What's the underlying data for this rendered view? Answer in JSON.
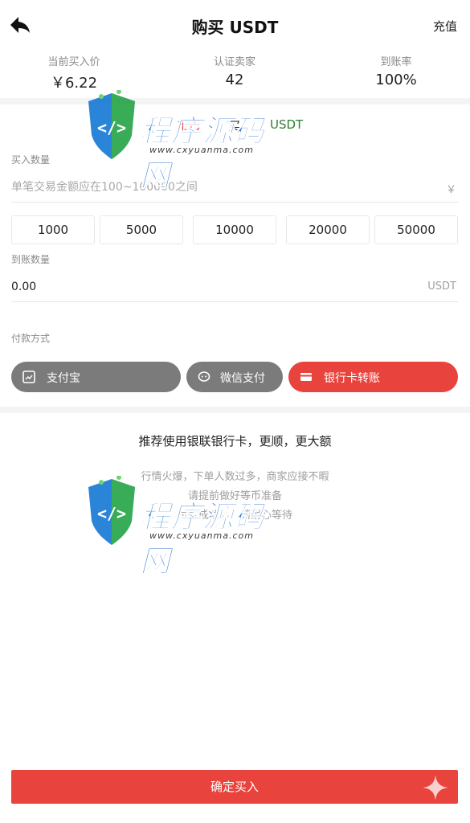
{
  "header": {
    "title": "购买 USDT",
    "recharge_label": "充值"
  },
  "stats": [
    {
      "label": "当前买入价",
      "value": "￥6.22"
    },
    {
      "label": "认证卖家",
      "value": "42"
    },
    {
      "label": "到账率",
      "value": "100%"
    }
  ],
  "tabs": [
    {
      "label": "币币"
    },
    {
      "label": "买"
    },
    {
      "label": "USDT"
    }
  ],
  "buy_amount": {
    "label": "买入数量",
    "placeholder": "单笔交易金额应在100~100000之间",
    "suffix": "￥"
  },
  "quick_amounts": [
    "1000",
    "5000",
    "10000",
    "20000",
    "50000"
  ],
  "receive_amount": {
    "label": "到账数量",
    "value": "0.00",
    "suffix": "USDT"
  },
  "payment": {
    "label": "付款方式",
    "methods": [
      {
        "label": "支付宝",
        "icon": "alipay-icon",
        "selected": false
      },
      {
        "label": "微信支付",
        "icon": "wechat-icon",
        "selected": false
      },
      {
        "label": "银行卡转账",
        "icon": "bank-card-icon",
        "selected": true
      }
    ]
  },
  "notice": {
    "title": "推荐使用银联银行卡，更顺，更大额",
    "lines": [
      "行情火爆，下单人数过多，商家应接不暇",
      "请提前做好等币准备",
      "付款成功后，请耐心等待"
    ]
  },
  "submit_label": "确定买入",
  "watermark": {
    "brand_part1": "程序",
    "brand_part2": "源码网",
    "url": "www.cxyuanma.com"
  },
  "colors": {
    "accent_red": "#e8433c",
    "pay_gray": "#7b7b7b",
    "tab_green": "#2e7d32"
  }
}
